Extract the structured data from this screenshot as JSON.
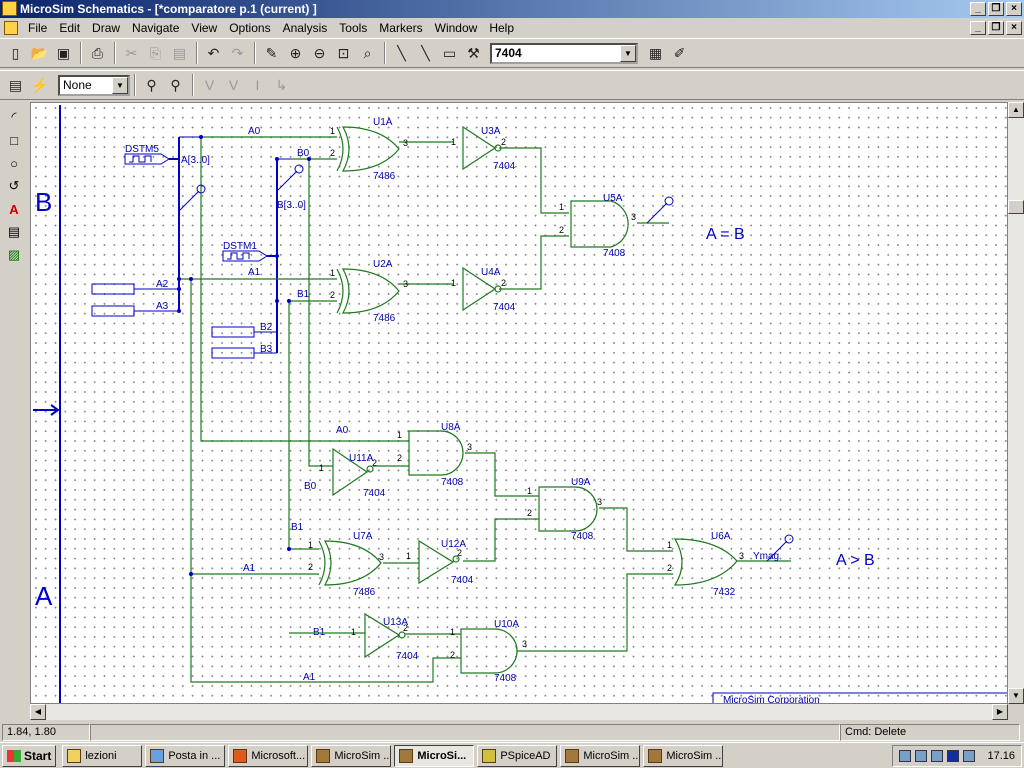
{
  "window": {
    "title": "MicroSim Schematics - [*comparatore  p.1 (current) ]"
  },
  "menu": [
    "File",
    "Edit",
    "Draw",
    "Navigate",
    "View",
    "Options",
    "Analysis",
    "Tools",
    "Markers",
    "Window",
    "Help"
  ],
  "toolbar": {
    "part_combo": "7404",
    "layer_combo": "None"
  },
  "colors": {
    "wire": "#1e7a1e",
    "bus": "#0000c8",
    "label": "#0000b0"
  },
  "schematic": {
    "ports": {
      "b": "B",
      "a": "A"
    },
    "stimuli": {
      "dstm5": "DSTM5",
      "dstm1": "DSTM1",
      "bus_a": "A[3..0]",
      "bus_b": "B[3..0]"
    },
    "nets": {
      "a0": "A0",
      "b0": "B0",
      "a1": "A1",
      "b1": "B1",
      "a2": "A2",
      "a3": "A3",
      "b2": "B2",
      "b3": "B3"
    },
    "parts": {
      "u1a": {
        "ref": "U1A",
        "type": "7486"
      },
      "u2a": {
        "ref": "U2A",
        "type": "7486"
      },
      "u3a": {
        "ref": "U3A",
        "type": "7404"
      },
      "u4a": {
        "ref": "U4A",
        "type": "7404"
      },
      "u5a": {
        "ref": "U5A",
        "type": "7408"
      },
      "u6a": {
        "ref": "U6A",
        "type": "7432"
      },
      "u7a": {
        "ref": "U7A",
        "type": "7486"
      },
      "u8a": {
        "ref": "U8A",
        "type": "7408"
      },
      "u9a": {
        "ref": "U9A",
        "type": "7408"
      },
      "u10a": {
        "ref": "U10A",
        "type": "7408"
      },
      "u11a": {
        "ref": "U11A",
        "type": "7404"
      },
      "u12a": {
        "ref": "U12A",
        "type": "7404"
      },
      "u13a": {
        "ref": "U13A",
        "type": "7404"
      }
    },
    "pins": {
      "p1": "1",
      "p2": "2",
      "p3": "3"
    },
    "output_net": "Ymag",
    "annotations": {
      "eq": "A = B",
      "gt": "A > B"
    },
    "titleblock": "MicroSim Corporation"
  },
  "status": {
    "coords": "1.84, 1.80",
    "cmd": "Cmd: Delete"
  },
  "taskbar": {
    "start": "Start",
    "buttons": [
      "lezioni",
      "Posta in ...",
      "Microsoft...",
      "MicroSim ...",
      "MicroSi...",
      "PSpiceAD",
      "MicroSim ...",
      "MicroSim ..."
    ],
    "clock": "17.16"
  }
}
